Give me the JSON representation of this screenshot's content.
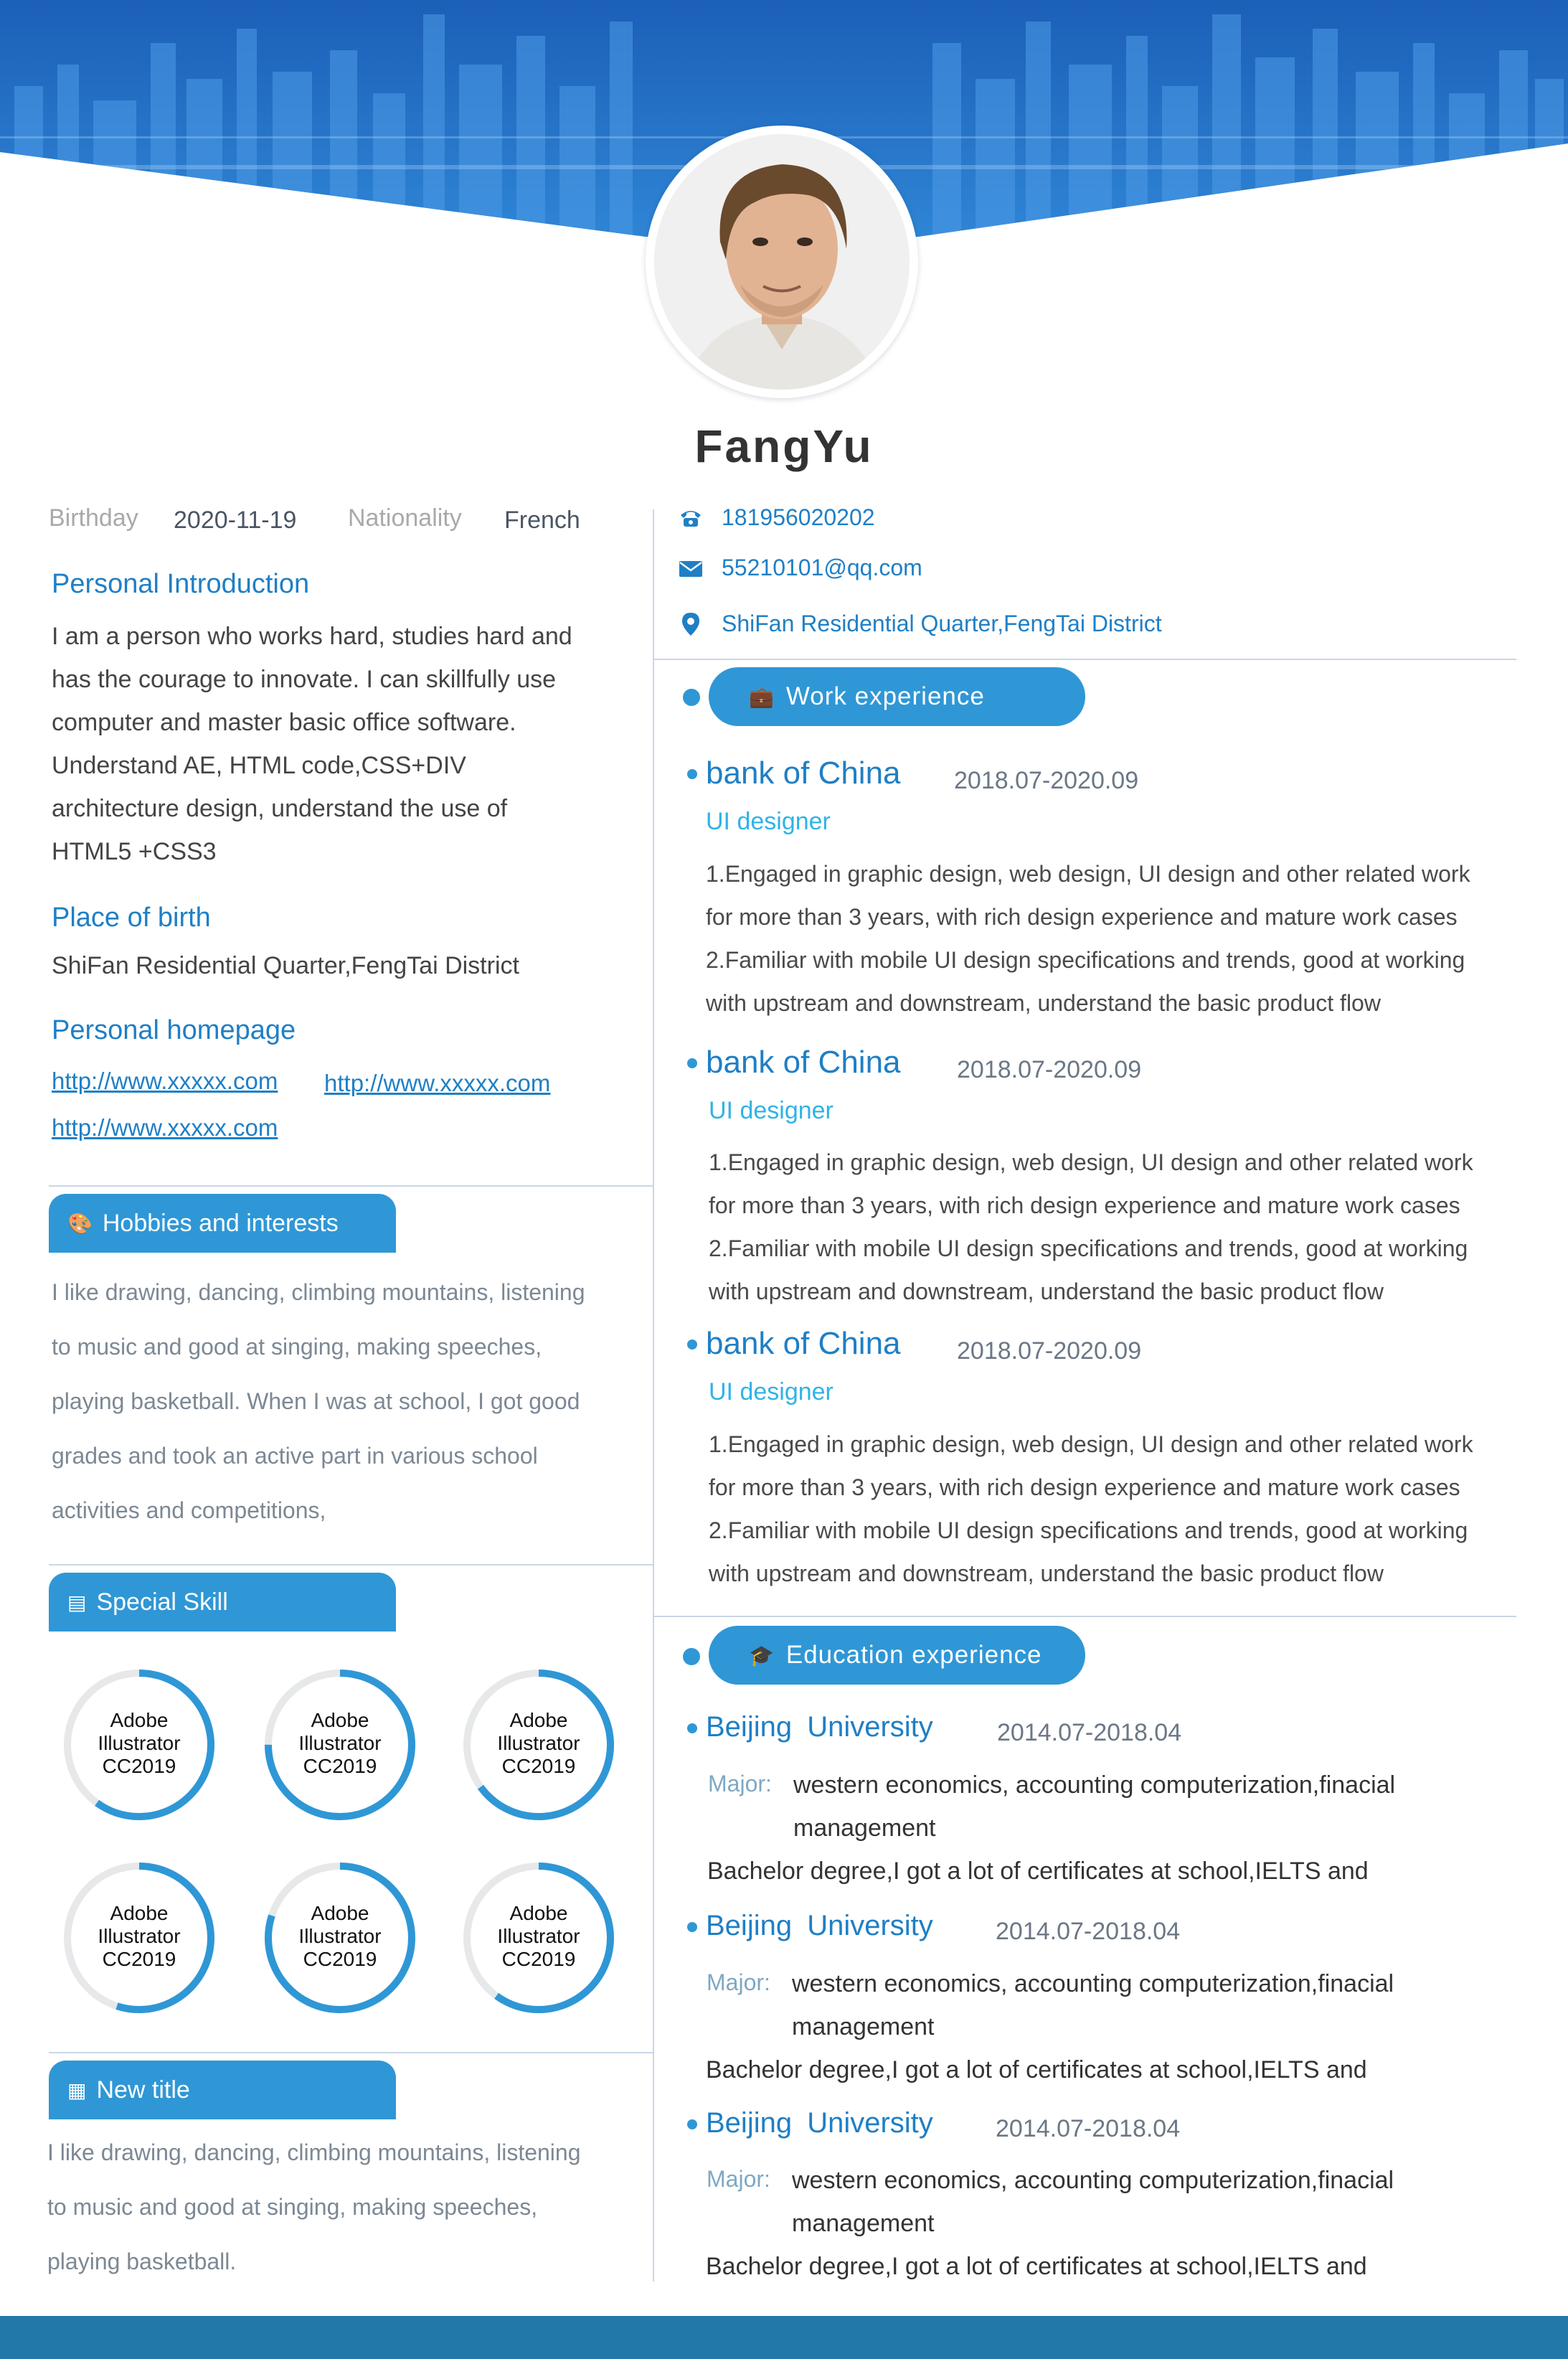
{
  "name": "FangYu",
  "personal": {
    "birthday_label": "Birthday",
    "birthday": "2020-11-19",
    "nationality_label": "Nationality",
    "nationality": "French"
  },
  "contact": {
    "phone": "181956020202",
    "email": "55210101@qq.com",
    "address": "ShiFan Residential Quarter,FengTai District"
  },
  "intro": {
    "title": "Personal Introduction",
    "lines": [
      "I am a person who works hard, studies hard and",
      "has the courage to innovate. I can skillfully use",
      "computer and master basic office software.",
      "Understand AE, HTML code,CSS+DIV",
      "architecture design, understand the use of",
      "HTML5 +CSS3"
    ]
  },
  "birthplace": {
    "title": "Place of birth",
    "value": "ShiFan Residential Quarter,FengTai District"
  },
  "homepage": {
    "title": "Personal homepage",
    "links": [
      "http://www.xxxxx.com",
      "http://www.xxxxx.com",
      "http://www.xxxxx.com"
    ]
  },
  "hobbies": {
    "title": "Hobbies and interests",
    "lines": [
      "I like drawing, dancing, climbing mountains, listening",
      "to music and good at singing, making speeches,",
      "playing basketball. When I was at school, I got good",
      "grades and took an active part in various school",
      "activities and competitions,"
    ]
  },
  "skills": {
    "title": "Special Skill",
    "items": [
      {
        "l1": "Adobe",
        "l2": "Illustrator",
        "l3": "CC2019",
        "level": 0.6
      },
      {
        "l1": "Adobe",
        "l2": "Illustrator",
        "l3": "CC2019",
        "level": 0.75
      },
      {
        "l1": "Adobe",
        "l2": "Illustrator",
        "l3": "CC2019",
        "level": 0.65
      },
      {
        "l1": "Adobe",
        "l2": "Illustrator",
        "l3": "CC2019",
        "level": 0.55
      },
      {
        "l1": "Adobe",
        "l2": "Illustrator",
        "l3": "CC2019",
        "level": 0.8
      },
      {
        "l1": "Adobe",
        "l2": "Illustrator",
        "l3": "CC2019",
        "level": 0.6
      }
    ]
  },
  "new_section": {
    "title": "New title",
    "lines": [
      "I like drawing, dancing, climbing mountains, listening",
      "to music and good at singing, making speeches,",
      "playing basketball."
    ]
  },
  "work": {
    "title": "Work experience",
    "items": [
      {
        "company": "bank of China",
        "date": "2018.07-2020.09",
        "role": "UI designer",
        "lines": [
          "1.Engaged in graphic design, web design, UI design and other related work",
          "for more than 3 years, with rich design experience and mature work cases",
          "2.Familiar with mobile UI design specifications and trends, good at working",
          "with upstream and downstream, understand the basic product flow"
        ]
      },
      {
        "company": "bank of China",
        "date": "2018.07-2020.09",
        "role": "UI designer",
        "lines": [
          "1.Engaged in graphic design, web design, UI design and other related work",
          "for more than 3 years, with rich design experience and mature work cases",
          "2.Familiar with mobile UI design specifications and trends, good at working",
          "with upstream and downstream, understand the basic product flow"
        ]
      },
      {
        "company": "bank of China",
        "date": "2018.07-2020.09",
        "role": "UI designer",
        "lines": [
          "1.Engaged in graphic design, web design, UI design and other related work",
          "for more than 3 years, with rich design experience and mature work cases",
          "2.Familiar with mobile UI design specifications and trends, good at working",
          "with upstream and downstream, understand the basic product flow"
        ]
      }
    ]
  },
  "education": {
    "title": "Education experience",
    "items": [
      {
        "school": "Beijing  University",
        "date": "2014.07-2018.04",
        "major_label": "Major:",
        "major1": "western economics, accounting computerization,finacial",
        "major2": "management",
        "degree": "Bachelor degree,I got a lot of certificates at school,IELTS and"
      },
      {
        "school": "Beijing  University",
        "date": "2014.07-2018.04",
        "major_label": "Major:",
        "major1": "western economics, accounting computerization,finacial",
        "major2": "management",
        "degree": "Bachelor degree,I got a lot of certificates at school,IELTS and"
      },
      {
        "school": "Beijing  University",
        "date": "2014.07-2018.04",
        "major_label": "Major:",
        "major1": "western economics, accounting computerization,finacial",
        "major2": "management",
        "degree": "Bachelor degree,I got a lot of certificates at school,IELTS and"
      }
    ]
  },
  "colors": {
    "accent": "#2f97d6",
    "title": "#1f7fc5",
    "footer": "#2278a8"
  }
}
